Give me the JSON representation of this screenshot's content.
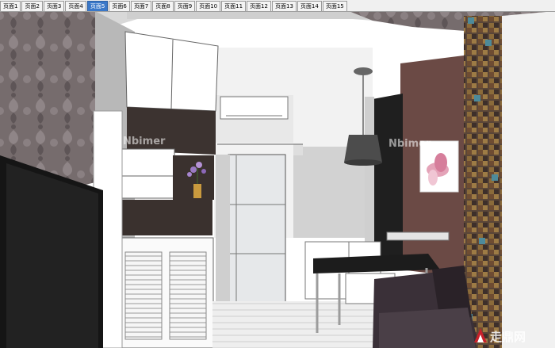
{
  "tabs": [
    {
      "label": "页面1"
    },
    {
      "label": "页面2"
    },
    {
      "label": "页面3"
    },
    {
      "label": "页面4"
    },
    {
      "label": "页面5",
      "active": true
    },
    {
      "label": "页面6"
    },
    {
      "label": "页面7"
    },
    {
      "label": "页面8"
    },
    {
      "label": "页面9"
    },
    {
      "label": "页面10"
    },
    {
      "label": "页面11"
    },
    {
      "label": "页面12"
    },
    {
      "label": "页面13"
    },
    {
      "label": "页面14"
    },
    {
      "label": "页面15"
    }
  ],
  "scene": {
    "watermark_left": "Nbimer",
    "watermark_right": "Nbimer",
    "logo_text": "走鼎网"
  },
  "colors": {
    "active_tab": "#3a78c9",
    "wall_brown": "#6b4a45",
    "wallpaper": "#6f6668",
    "sofa": "#3a3038"
  }
}
